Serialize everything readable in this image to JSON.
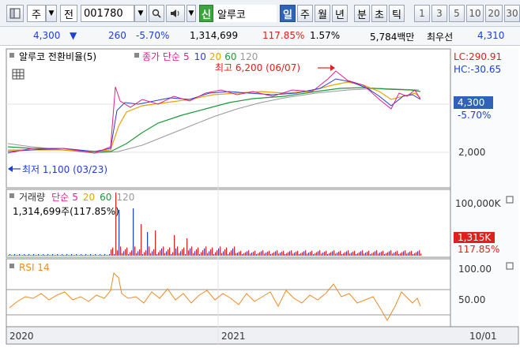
{
  "toolbar": {
    "market": "주",
    "type": "전",
    "code": "001780",
    "new_badge": "신",
    "stock_name": "알루코",
    "periods": [
      "일",
      "주",
      "월",
      "년",
      "분",
      "초",
      "틱"
    ],
    "active_period": "일",
    "intervals": [
      "1",
      "3",
      "5",
      "10",
      "20",
      "30"
    ]
  },
  "quote": {
    "price": "4,300",
    "arrow": "▼",
    "change": "260",
    "change_pct": "-5.70%",
    "volume": "1,314,699",
    "volume_ratio": "117.85%",
    "turnover": "1.57%",
    "amount": "5,784백만",
    "pref_label": "최우선",
    "pref_price": "4,310"
  },
  "price_panel": {
    "title": "알루코 전환비율(5)",
    "ma_label": "종가 단순",
    "ma_periods": [
      "5",
      "10",
      "20",
      "60",
      "120"
    ],
    "ma_colors": [
      "#e0208f",
      "#2a3fd8",
      "#e8a400",
      "#1d9a3a",
      "#999999"
    ],
    "high_note": "최고 6,200 (06/07)",
    "low_note": "최저 1,100 (03/23)",
    "lc_label": "LC:290.91",
    "hc_label": "HC:-30.65",
    "axis_labels": [
      "2,000"
    ],
    "current_price": "4,300",
    "current_change": "-5.70%"
  },
  "volume_panel": {
    "title": "거래량",
    "ma_label": "단순",
    "ma_periods": [
      "5",
      "20",
      "60",
      "120"
    ],
    "ma_colors": [
      "#e0208f",
      "#e8a400",
      "#1d9a3a",
      "#999999"
    ],
    "value_text": "1,314,699주(117.85%)",
    "axis_top": "100,000K",
    "current_volume": "1,315K",
    "current_pct": "117.85%"
  },
  "rsi_panel": {
    "title": "RSI 14",
    "axis_labels": [
      "100.00",
      "50.00"
    ]
  },
  "date_axis": {
    "labels": [
      "2020",
      "2021"
    ],
    "end_label": "10/01"
  },
  "colors": {
    "up": "#e0201a",
    "down": "#1c3fd8",
    "price_tag_bg": "#2f63b5",
    "volume_tag_bg": "#e0201a",
    "rsi": "#f08a24",
    "grid": "#d9d9d9"
  }
}
